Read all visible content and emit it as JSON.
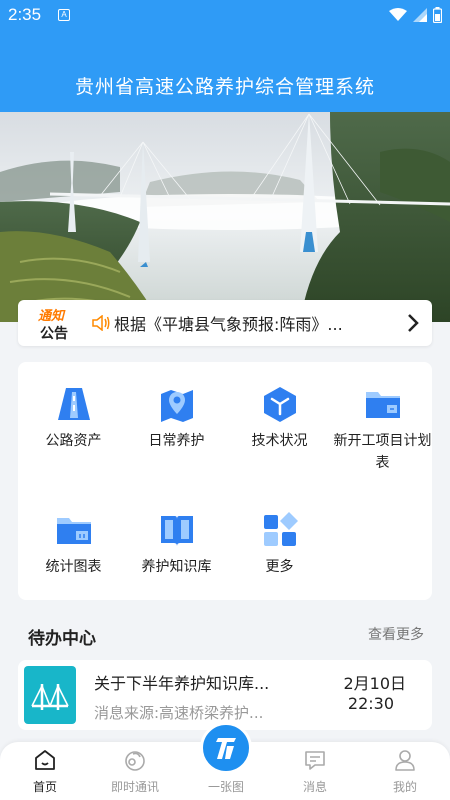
{
  "status_bar": {
    "time": "2:35",
    "notification_letter": "A"
  },
  "app": {
    "title": "贵州省高速公路养护综合管理系统"
  },
  "notice": {
    "badge_top": "通知",
    "badge_bottom": "公告",
    "text": "根据《平塘县气象预报:阵雨》..."
  },
  "grid": {
    "items": [
      {
        "label": "公路资产",
        "icon": "road-icon"
      },
      {
        "label": "日常养护",
        "icon": "map-pin-icon"
      },
      {
        "label": "技术状况",
        "icon": "cube-icon"
      },
      {
        "label": "新开工项目计划表",
        "icon": "folder-plan-icon"
      },
      {
        "label": "统计图表",
        "icon": "folder-stats-icon"
      },
      {
        "label": "养护知识库",
        "icon": "book-icon"
      },
      {
        "label": "更多",
        "icon": "more-grid-icon"
      }
    ]
  },
  "todo": {
    "title": "待办中心",
    "more": "查看更多",
    "items": [
      {
        "title": "关于下半年养护知识库...",
        "source": "消息来源:高速桥梁养护...",
        "date": "2月10日",
        "time": "22:30"
      }
    ]
  },
  "tabbar": {
    "tabs": [
      {
        "label": "首页",
        "icon": "home-icon",
        "active": true
      },
      {
        "label": "即时通讯",
        "icon": "chat-icon",
        "active": false
      },
      {
        "label": "一张图",
        "icon": "onemap-icon",
        "active": false
      },
      {
        "label": "消息",
        "icon": "message-icon",
        "active": false
      },
      {
        "label": "我的",
        "icon": "user-icon",
        "active": false
      }
    ]
  },
  "colors": {
    "brand": "#2f9bf6",
    "fab": "#1e8ff0",
    "accent_orange": "#ff7a00",
    "teal_thumb": "#18b6c9"
  }
}
